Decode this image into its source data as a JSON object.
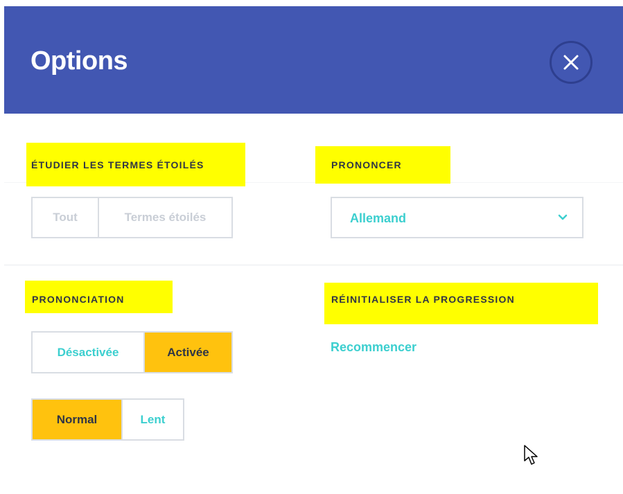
{
  "header": {
    "title": "Options",
    "close_icon": "close-icon",
    "background": "#4257b2"
  },
  "study_starred": {
    "label": "ÉTUDIER LES TERMES ÉTOILÉS",
    "options": [
      "Tout",
      "Termes étoilés"
    ],
    "state": "disabled"
  },
  "pronounce": {
    "label": "PRONONCER",
    "selected": "Allemand",
    "icon": "chevron-down-icon"
  },
  "pronunciation": {
    "label": "PRONONCIATION",
    "toggle_options": [
      "Désactivée",
      "Activée"
    ],
    "toggle_selected": "Activée",
    "speed_options": [
      "Normal",
      "Lent"
    ],
    "speed_selected": "Normal"
  },
  "reset": {
    "label": "RÉINITIALISER LA PROGRESSION",
    "link": "Recommencer"
  },
  "colors": {
    "accent": "#3ccfcf",
    "selected": "#ffc20e",
    "highlight": "#ffff00",
    "header": "#4257b2"
  }
}
